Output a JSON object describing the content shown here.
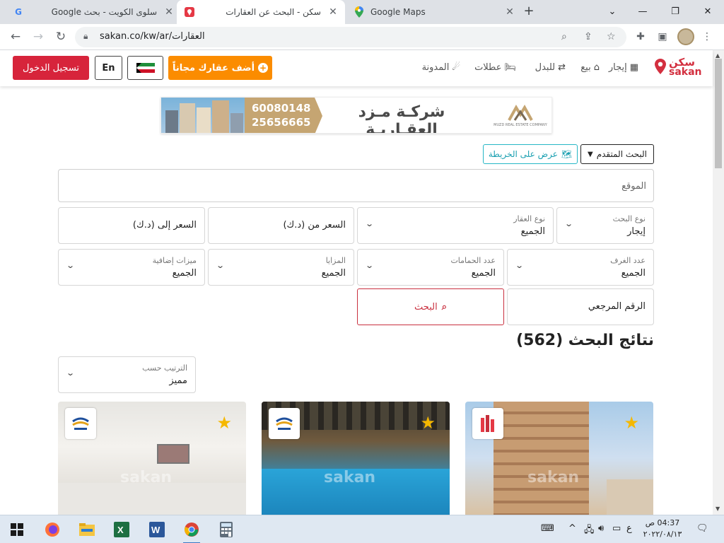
{
  "browser": {
    "tabs": [
      {
        "title": "سلوى الكويت - بحث Google",
        "favicon": "google-icon",
        "active": false
      },
      {
        "title": "سكن - البحث عن العقارات",
        "favicon": "sakan-pin-icon",
        "active": true
      },
      {
        "title": "Google Maps",
        "favicon": "maps-icon",
        "active": false
      }
    ],
    "new_tab_label": "+",
    "url": "sakan.co/kw/ar/العقارات"
  },
  "site": {
    "logo_ar": "سكن",
    "logo_en": "sakan",
    "nav": [
      {
        "label": "إيجار",
        "icon": "building-icon"
      },
      {
        "label": "بيع",
        "icon": "home-icon"
      },
      {
        "label": "للبدل",
        "icon": "swap-icon"
      },
      {
        "label": "عطلات",
        "icon": "bed-icon"
      },
      {
        "label": "المدونة",
        "icon": "rss-icon"
      }
    ],
    "add_property_label": "أضف عقارك مجاناً",
    "lang_label": "En",
    "login_label": "تسجيل الدخول"
  },
  "banner": {
    "phone1": "60080148",
    "phone2": "25656665",
    "company_ar": "شركـة مـزد العقـاريـة",
    "company_sub": "MUZD REAL ESTATE COMPANY"
  },
  "search": {
    "advanced_label": "البحث المتقدم",
    "map_label": "عرض على الخريطة",
    "location_placeholder": "الموقع",
    "search_type": {
      "label": "نوع البحث",
      "value": "إيجار"
    },
    "property_type": {
      "label": "نوع العقار",
      "value": "الجميع"
    },
    "price_from": "السعر من (د.ك)",
    "price_to": "السعر إلى (د.ك)",
    "rooms": {
      "label": "عدد الغرف",
      "value": "الجميع"
    },
    "baths": {
      "label": "عدد الحمامات",
      "value": "الجميع"
    },
    "features": {
      "label": "المزايا",
      "value": "الجميع"
    },
    "extras": {
      "label": "ميزات إضافية",
      "value": "الجميع"
    },
    "ref_placeholder": "الرقم المرجعي",
    "search_button": "البحث"
  },
  "results": {
    "title": "نتائج البحث (562)",
    "sort": {
      "label": "الترتيب حسب",
      "value": "مميز"
    },
    "watermark": "sakan"
  },
  "taskbar": {
    "time": "04:37 ص",
    "date": "٢٠٢٢/٠٨/١٣",
    "lang": "ع"
  }
}
